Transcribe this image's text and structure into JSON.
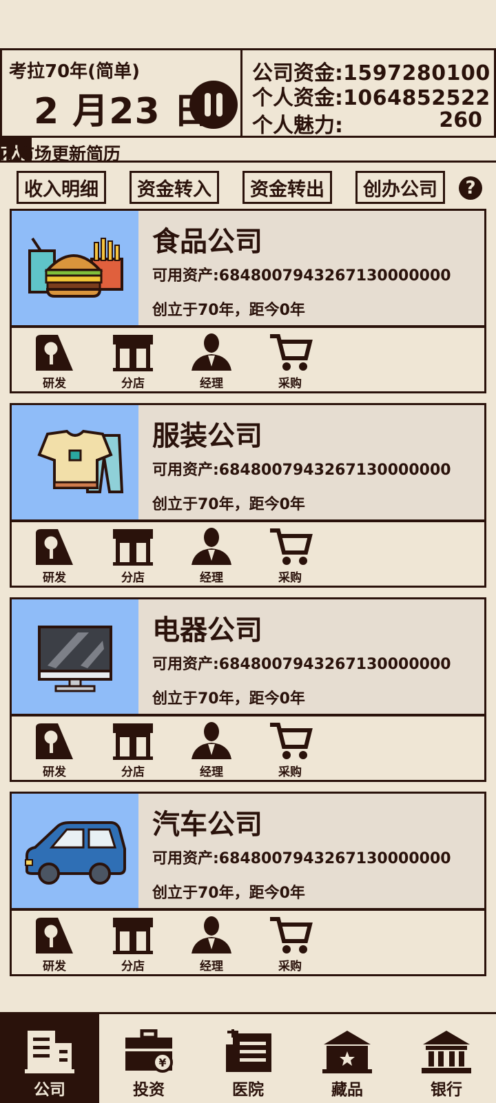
{
  "header": {
    "era": "考拉70年(简单)",
    "date": "2 月23 日",
    "company_funds_label": "公司资金:",
    "company_funds_value": "1597280100",
    "personal_funds_label": "个人资金:",
    "personal_funds_value": "1064852522",
    "charm_label": "个人魅力:",
    "charm_value": "260"
  },
  "ticker": {
    "masked": "]人",
    "text": "才市场更新简历"
  },
  "actions": [
    {
      "label": "收入明细"
    },
    {
      "label": "资金转入"
    },
    {
      "label": "资金转出"
    },
    {
      "label": "创办公司"
    }
  ],
  "help_symbol": "?",
  "companies": [
    {
      "name": "食品公司",
      "assets": "可用资产:6848007943267130000000",
      "founded": "创立于70年，距今0年",
      "icon": "burger-icon"
    },
    {
      "name": "服装公司",
      "assets": "可用资产:6848007943267130000000",
      "founded": "创立于70年，距今0年",
      "icon": "clothes-icon"
    },
    {
      "name": "电器公司",
      "assets": "可用资产:6848007943267130000000",
      "founded": "创立于70年，距今0年",
      "icon": "monitor-icon"
    },
    {
      "name": "汽车公司",
      "assets": "可用资产:6848007943267130000000",
      "founded": "创立于70年，距今0年",
      "icon": "car-icon"
    }
  ],
  "tools": [
    {
      "label": "研发",
      "icon": "research-icon"
    },
    {
      "label": "分店",
      "icon": "store-icon"
    },
    {
      "label": "经理",
      "icon": "manager-icon"
    },
    {
      "label": "采购",
      "icon": "cart-icon"
    }
  ],
  "nav": [
    {
      "label": "公司",
      "icon": "company-icon",
      "active": true
    },
    {
      "label": "投资",
      "icon": "briefcase-icon",
      "active": false
    },
    {
      "label": "医院",
      "icon": "hospital-icon",
      "active": false
    },
    {
      "label": "藏品",
      "icon": "museum-icon",
      "active": false
    },
    {
      "label": "银行",
      "icon": "bank-icon",
      "active": false
    }
  ],
  "colors": {
    "background": "#efe6d5",
    "ink": "#2a120b",
    "card_panel": "#e6ddd1",
    "image_bg": "#8fbcf8"
  }
}
